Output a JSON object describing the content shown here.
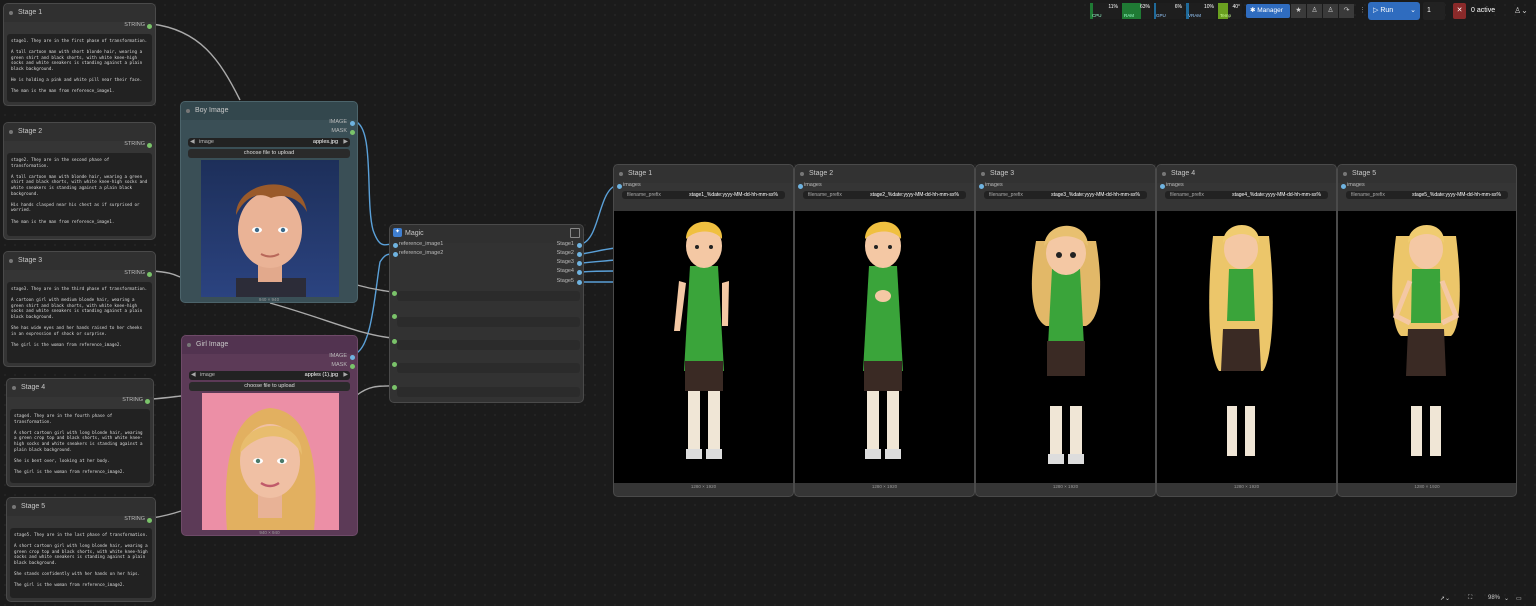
{
  "colors": {
    "accent": "#2f6cbf",
    "node_bg": "#353535",
    "boy_node": "#3a4f56",
    "girl_node": "#5c3a57",
    "link_blue": "#5aa0d8"
  },
  "text_nodes": [
    {
      "title": "Stage 1",
      "output": "STRING",
      "text": "stage1. They are in the first phase of transformation.\n\nA tall cartoon man with short blonde hair, wearing a green shirt and black shorts, with white knee-high socks and white sneakers is standing against a plain black background.\n\nHe is holding a pink and white pill near their face.\n\nThe man is the man from reference_image1."
    },
    {
      "title": "Stage 2",
      "output": "STRING",
      "text": "stage2. They are in the second phase of transformation.\n\nA tall cartoon man with blonde hair, wearing a green shirt and black shorts, with white knee-high socks and white sneakers is standing against a plain black background.\n\nHis hands clasped near his chest as if surprised or worried.\n\nThe man is the man from reference_image1."
    },
    {
      "title": "Stage 3",
      "output": "STRING",
      "text": "stage3. They are in the third phase of transformation.\n\nA cartoon girl with medium blonde hair, wearing a green shirt and black shorts, with white knee-high socks and white sneakers is standing against a plain black background.\n\nShe has wide eyes and her hands raised to her cheeks in an expression of shock or surprise.\n\nThe girl is the woman from reference_image2."
    },
    {
      "title": "Stage 4",
      "output": "STRING",
      "text": "stage4. They are in the fourth phase of transformation.\n\nA short cartoon girl with long blonde hair, wearing a green crop top and black shorts, with white knee-high socks and white sneakers is standing against a plain black background.\n\nShe is bent over, looking at her body.\n\nThe girl is the woman from reference_image2."
    },
    {
      "title": "Stage 5",
      "output": "STRING",
      "text": "stage5. They are in the last phase of transformation.\n\nA short cartoon girl with long blonde hair, wearing a green crop top and black shorts, with white knee-high socks and white sneakers is standing against a plain black background.\n\nShe stands confidently with her hands on her hips.\n\nThe girl is the woman from reference_image2."
    }
  ],
  "boy_image": {
    "title": "Boy Image",
    "out_image": "IMAGE",
    "out_mask": "MASK",
    "widget_label": "image",
    "widget_value": "apples.jpg",
    "upload": "choose file to upload",
    "size": "940 × 940"
  },
  "girl_image": {
    "title": "Girl Image",
    "out_image": "IMAGE",
    "out_mask": "MASK",
    "widget_label": "image",
    "widget_value": "apples (1).jpg",
    "upload": "choose file to upload",
    "size": "940 × 940"
  },
  "magic": {
    "title": "Magic",
    "inputs": [
      "reference_image1",
      "reference_image2"
    ],
    "outputs": [
      "Stage1",
      "Stage2",
      "Stage3",
      "Stage4",
      "Stage5"
    ]
  },
  "save_nodes": [
    {
      "title": "Stage 1",
      "input": "images",
      "fp_label": "filename_prefix",
      "fp_value": "stage1_%date:yyyy-MM-dd-hh-mm-ss%",
      "size": "1280 × 1920"
    },
    {
      "title": "Stage 2",
      "input": "images",
      "fp_label": "filename_prefix",
      "fp_value": "stage2_%date:yyyy-MM-dd-hh-mm-ss%",
      "size": "1280 × 1920"
    },
    {
      "title": "Stage 3",
      "input": "images",
      "fp_label": "filename_prefix",
      "fp_value": "stage3_%date:yyyy-MM-dd-hh-mm-ss%",
      "size": "1280 × 1920"
    },
    {
      "title": "Stage 4",
      "input": "images",
      "fp_label": "filename_prefix",
      "fp_value": "stage4_%date:yyyy-MM-dd-hh-mm-ss%",
      "size": "1280 × 1920"
    },
    {
      "title": "Stage 5",
      "input": "images",
      "fp_label": "filename_prefix",
      "fp_value": "stage5_%date:yyyy-MM-dd-hh-mm-ss%",
      "size": "1280 × 1920"
    }
  ],
  "topbar": {
    "meters": [
      {
        "label": "CPU",
        "value": "11%",
        "fill": 0.11
      },
      {
        "label": "RAM",
        "value": "63%",
        "fill": 0.63
      },
      {
        "label": "GPU",
        "value": "6%",
        "fill": 0.06
      },
      {
        "label": "VRAM",
        "value": "10%",
        "fill": 0.1
      },
      {
        "label": "Temp",
        "value": "40°",
        "fill": 0.4
      }
    ],
    "manager": "Manager",
    "run": "Run",
    "batch": "1",
    "active": "0 active"
  },
  "bottom": {
    "zoom": "98%"
  }
}
